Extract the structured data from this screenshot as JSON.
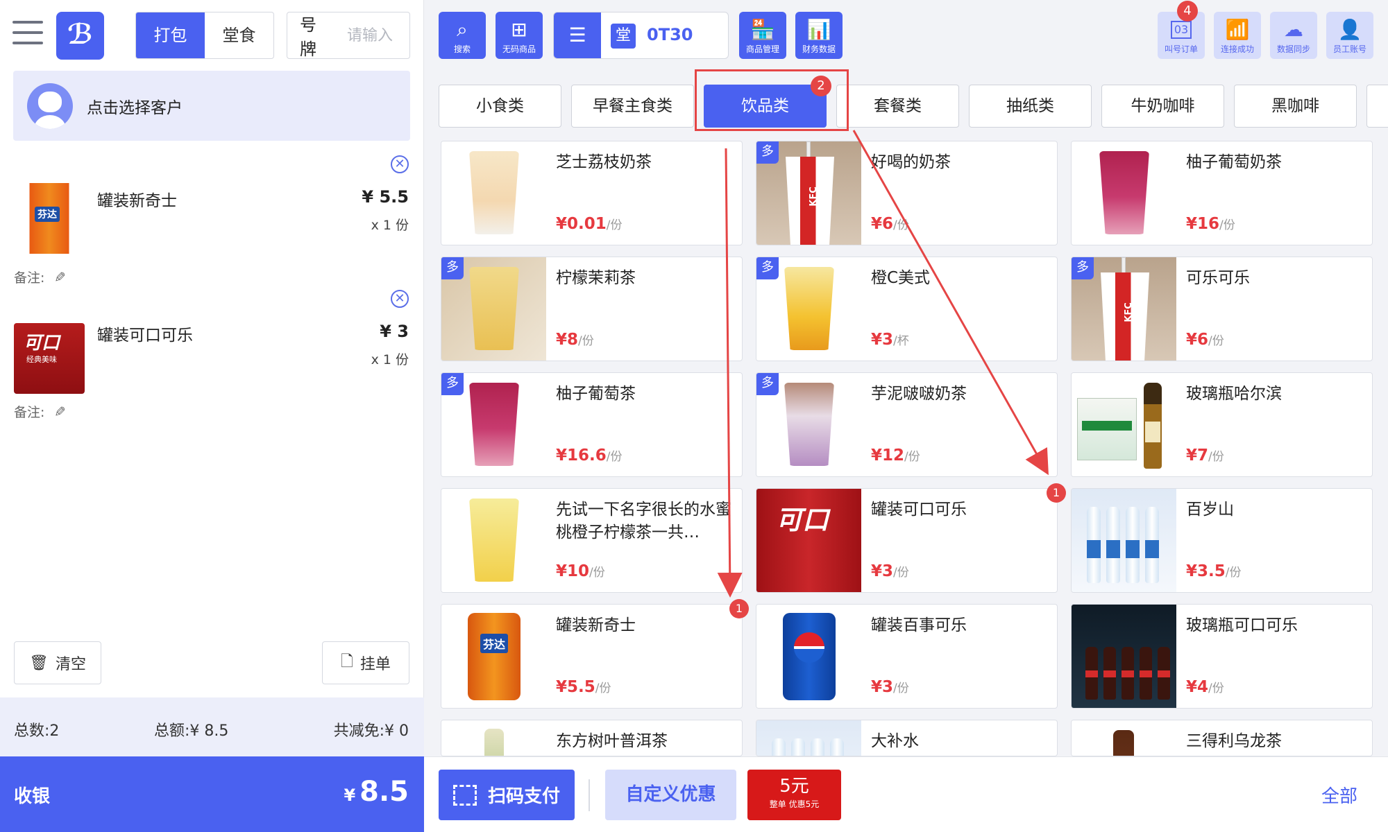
{
  "header": {
    "tabs": [
      "打包",
      "堂食"
    ],
    "active_tab": "打包",
    "plate_label": "号牌",
    "plate_placeholder": "请输入"
  },
  "customer": {
    "label": "点击选择客户"
  },
  "order_items": [
    {
      "name": "罐装新奇士",
      "price": "¥ 5.5",
      "qty": "x 1 份",
      "note_label": "备注:",
      "image": "fanta-can"
    },
    {
      "name": "罐装可口可乐",
      "price": "¥ 3",
      "qty": "x 1 份",
      "note_label": "备注:",
      "image": "coke-can"
    }
  ],
  "actions": {
    "clear": "清空",
    "hold": "挂单"
  },
  "summary": {
    "count": "总数:2",
    "total": "总额:¥ 8.5",
    "discount": "共减免:¥ 0"
  },
  "checkout": {
    "label": "收银",
    "currency": "¥",
    "amount": "8.5"
  },
  "toolbar": {
    "search": "搜索",
    "no_code": "无码商品",
    "table_tag": "堂",
    "table_number": "0T30",
    "goods_manage": "商品管理",
    "finance": "财务数据",
    "call_orders": "叫号订单",
    "call_badge": "4",
    "call_icon_num": "03",
    "connected": "连接成功",
    "sync": "数据同步",
    "staff": "员工账号"
  },
  "categories": [
    "小食类",
    "早餐主食类",
    "饮品类",
    "套餐类",
    "抽纸类",
    "牛奶咖啡",
    "黑咖啡"
  ],
  "active_category": "饮品类",
  "category_badge": "2",
  "products": [
    {
      "name": "芝士荔枝奶茶",
      "price": "¥0.01",
      "unit": "/份",
      "multi": false,
      "image": "lychee-tea"
    },
    {
      "name": "好喝的奶茶",
      "price": "¥6",
      "unit": "/份",
      "multi": true,
      "image": "kfc-cup"
    },
    {
      "name": "柚子葡萄奶茶",
      "price": "¥16",
      "unit": "/份",
      "multi": false,
      "image": "grape-tea"
    },
    {
      "name": "柠檬茉莉茶",
      "price": "¥8",
      "unit": "/份",
      "multi": true,
      "image": "lemon-tea"
    },
    {
      "name": "橙C美式",
      "price": "¥3",
      "unit": "/杯",
      "multi": true,
      "image": "orange-coffee"
    },
    {
      "name": "可乐可乐",
      "price": "¥6",
      "unit": "/份",
      "multi": true,
      "image": "kfc-cup"
    },
    {
      "name": "柚子葡萄茶",
      "price": "¥16.6",
      "unit": "/份",
      "multi": true,
      "image": "grape-tea"
    },
    {
      "name": "芋泥啵啵奶茶",
      "price": "¥12",
      "unit": "/份",
      "multi": true,
      "image": "taro-tea"
    },
    {
      "name": "玻璃瓶哈尔滨",
      "price": "¥7",
      "unit": "/份",
      "multi": false,
      "image": "beer"
    },
    {
      "name": "先试一下名字很长的水蜜桃橙子柠檬茶一共…",
      "price": "¥10",
      "unit": "/份",
      "multi": false,
      "image": "peach-tea"
    },
    {
      "name": "罐装可口可乐",
      "price": "¥3",
      "unit": "/份",
      "multi": false,
      "image": "coke-can"
    },
    {
      "name": "百岁山",
      "price": "¥3.5",
      "unit": "/份",
      "multi": false,
      "image": "water"
    },
    {
      "name": "罐装新奇士",
      "price": "¥5.5",
      "unit": "/份",
      "multi": false,
      "image": "fanta-can"
    },
    {
      "name": "罐装百事可乐",
      "price": "¥3",
      "unit": "/份",
      "multi": false,
      "image": "pepsi-can"
    },
    {
      "name": "玻璃瓶可口可乐",
      "price": "¥4",
      "unit": "/份",
      "multi": false,
      "image": "cola-bottles"
    },
    {
      "name": "东方树叶普洱茶",
      "price": "",
      "unit": "",
      "multi": false,
      "image": "tea-bottle"
    },
    {
      "name": "大补水",
      "price": "",
      "unit": "",
      "multi": false,
      "image": "water"
    },
    {
      "name": "三得利乌龙茶",
      "price": "",
      "unit": "",
      "multi": false,
      "image": "oolong"
    }
  ],
  "multi_tag": "多",
  "annotation_badges": [
    "2",
    "1",
    "1"
  ],
  "bottom": {
    "scan_pay": "扫码支付",
    "custom_discount": "自定义优惠",
    "coupon_amount": "5元",
    "coupon_desc": "整单 优惠5元",
    "all": "全部"
  },
  "colors": {
    "accent": "#4a61f0",
    "price": "#e6393f",
    "badge": "#e54545",
    "coupon": "#d71919"
  }
}
